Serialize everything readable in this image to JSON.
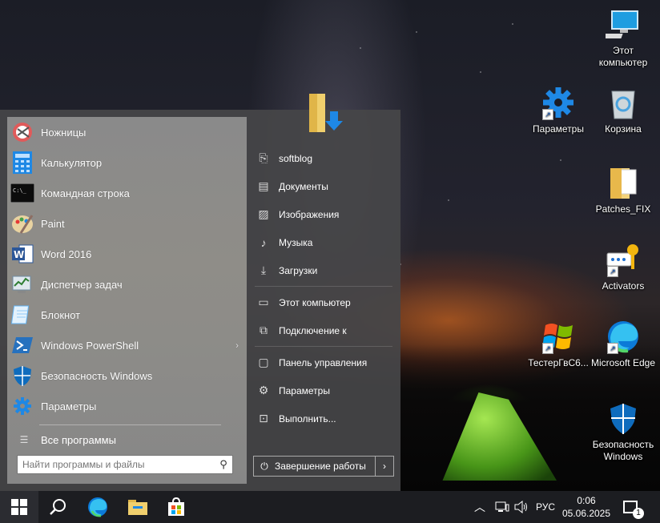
{
  "desktop": {
    "icons": [
      {
        "label": "Этот компьютер",
        "icon": "computer-icon"
      },
      {
        "label": "Параметры",
        "icon": "gear-icon"
      },
      {
        "label": "Корзина",
        "icon": "recycle-bin-icon"
      },
      {
        "label": "Patches_FIX",
        "icon": "folder-icon"
      },
      {
        "label": "Activators",
        "icon": "key-icon"
      },
      {
        "label": "ТестерГвС6...",
        "icon": "windows-logo-icon"
      },
      {
        "label": "Microsoft Edge",
        "icon": "edge-icon"
      },
      {
        "label": "Безопасность Windows",
        "icon": "shield-icon"
      }
    ]
  },
  "start_menu": {
    "apps": [
      {
        "label": "Ножницы",
        "icon": "scissors-icon"
      },
      {
        "label": "Калькулятор",
        "icon": "calculator-icon"
      },
      {
        "label": "Командная строка",
        "icon": "terminal-icon"
      },
      {
        "label": "Paint",
        "icon": "paint-icon"
      },
      {
        "label": "Word 2016",
        "icon": "word-icon"
      },
      {
        "label": "Диспетчер задач",
        "icon": "task-manager-icon"
      },
      {
        "label": "Блокнот",
        "icon": "notepad-icon"
      },
      {
        "label": "Windows PowerShell",
        "icon": "powershell-icon"
      },
      {
        "label": "Безопасность Windows",
        "icon": "shield-icon"
      },
      {
        "label": "Параметры",
        "icon": "gear-icon"
      }
    ],
    "all_programs": "Все программы",
    "search_placeholder": "Найти программы и файлы",
    "places": [
      {
        "label": "softblog",
        "icon": "user-icon"
      },
      {
        "label": "Документы",
        "icon": "document-icon"
      },
      {
        "label": "Изображения",
        "icon": "image-icon"
      },
      {
        "label": "Музыка",
        "icon": "music-icon"
      },
      {
        "label": "Загрузки",
        "icon": "download-icon"
      },
      {
        "label": "Этот компьютер",
        "icon": "computer-icon"
      },
      {
        "label": "Подключение к",
        "icon": "connect-icon"
      },
      {
        "label": "Панель управления",
        "icon": "control-panel-icon"
      },
      {
        "label": "Параметры",
        "icon": "gear-icon"
      },
      {
        "label": "Выполнить...",
        "icon": "run-icon"
      }
    ],
    "shutdown_label": "Завершение работы"
  },
  "taskbar": {
    "language": "РУС",
    "time": "0:06",
    "date": "05.06.2025",
    "notification_count": "1"
  },
  "colors": {
    "accent_blue": "#1e88e5",
    "taskbar_bg": "#1c1d21",
    "start_left_bg": "#8c8b87"
  }
}
